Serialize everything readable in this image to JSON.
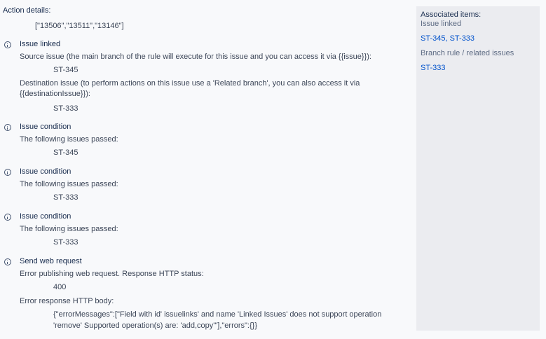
{
  "action_details": {
    "label": "Action details:",
    "value": "[\"13506\",\"13511\",\"13146\"]"
  },
  "entries": [
    {
      "icon": "info-icon",
      "title": "Issue linked",
      "source_text": "Source issue (the main branch of the rule will execute for this issue and you can access it via {{issue}}):",
      "source_value": "ST-345",
      "dest_text_1": "Destination issue (to perform actions on this issue use a 'Related branch', you can also access it via",
      "dest_text_2": "{{destinationIssue}}):",
      "dest_value": "ST-333"
    },
    {
      "icon": "info-icon",
      "title": "Issue condition",
      "text": "The following issues passed:",
      "value": "ST-345"
    },
    {
      "icon": "info-icon",
      "title": "Issue condition",
      "text": "The following issues passed:",
      "value": "ST-333"
    },
    {
      "icon": "info-icon",
      "title": "Issue condition",
      "text": "The following issues passed:",
      "value": "ST-333"
    },
    {
      "icon": "info-icon",
      "title": "Send web request",
      "status_text": "Error publishing web request. Response HTTP status:",
      "status_value": "400",
      "body_label": "Error response HTTP body:",
      "body_line_1": "{\"errorMessages\":[\"Field with id' issuelinks' and name 'Linked Issues' does not support operation",
      "body_line_2": "'remove' Supported operation(s) are: 'add,copy'\"],\"errors\":{}}"
    }
  ],
  "sidebar": {
    "title": "Associated items:",
    "issue_linked_label": "Issue linked",
    "issue_linked_links": "ST-345, ST-333",
    "branch_label": "Branch rule / related issues",
    "branch_links": "ST-333"
  }
}
